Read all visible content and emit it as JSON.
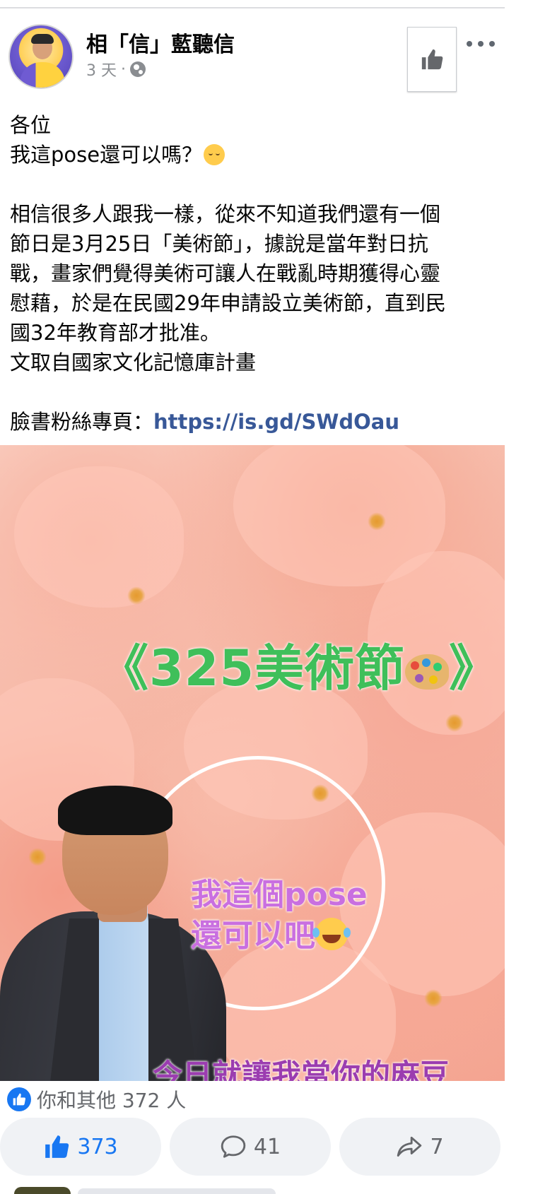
{
  "post": {
    "author": "相「信」藍聽信",
    "time": "3 天",
    "separator": "·",
    "text_lines": [
      "各位",
      "我這pose還可以嗎？",
      "",
      "相信很多人跟我一樣，從來不知道我們還有一個",
      "節日是3月25日「美術節」，據說是當年對日抗",
      "戰，畫家們覺得美術可讓人在戰亂時期獲得心靈",
      "慰藉，於是在民國29年申請設立美術節，直到民",
      "國32年教育部才批准。",
      "文取自國家文化記憶庫計畫",
      ""
    ],
    "link_prefix": "臉書粉絲專頁：",
    "link_url": "https://is.gd/SWdOau"
  },
  "image": {
    "title_left": "《325美術節",
    "title_right": "》",
    "caption_line1": "我這個pose",
    "caption_line2": "還可以吧",
    "bottom_text": "今日就讓我當你的麻豆"
  },
  "reactions": {
    "summary": "你和其他 372 人"
  },
  "actions": {
    "like_count": "373",
    "comment_count": "41",
    "share_count": "7"
  },
  "colors": {
    "accent": "#1877f2",
    "link": "#385898",
    "title_green": "#3fbf5a",
    "caption_purple": "#c96fe0"
  },
  "icons": {
    "like_page": "thumbs-up-icon",
    "more": "more-horizontal-icon",
    "audience": "globe-icon",
    "like": "thumbs-up-icon",
    "comment": "comment-icon",
    "share": "share-icon"
  }
}
